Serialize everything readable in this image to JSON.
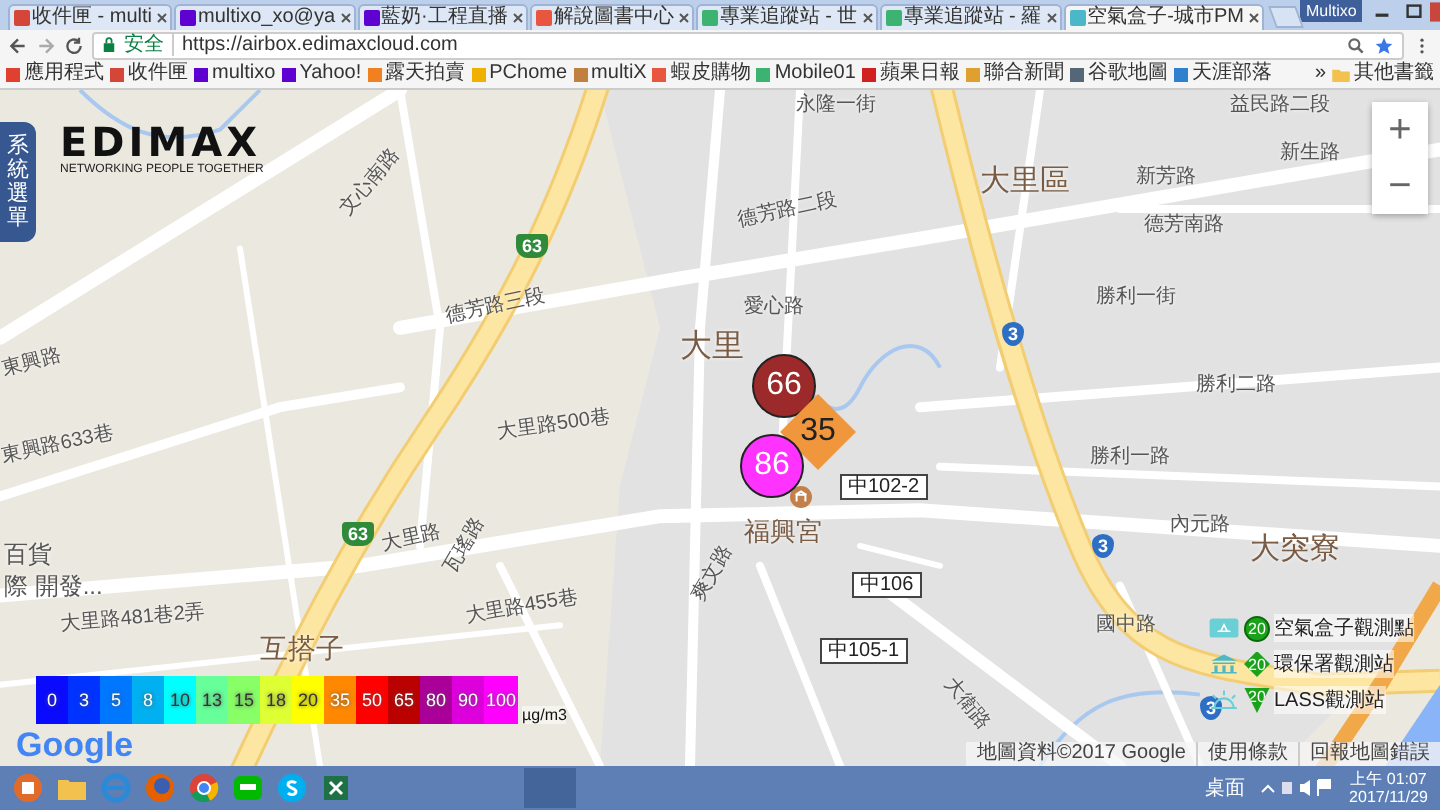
{
  "browser": {
    "tabs": [
      {
        "title": "收件匣 - multi",
        "color": "#d44638",
        "selected": false
      },
      {
        "title": "multixo_xo@ya",
        "color": "#5f01d1",
        "selected": false
      },
      {
        "title": "藍奶·工程直播",
        "color": "#5f01d1",
        "selected": false
      },
      {
        "title": "解說圖書中心",
        "color": "#e8563f",
        "selected": false
      },
      {
        "title": "專業追蹤站 - 世",
        "color": "#3cb371",
        "selected": false
      },
      {
        "title": "專業追蹤站 - 羅",
        "color": "#3cb371",
        "selected": false
      },
      {
        "title": "空氣盒子-城市PM",
        "color": "#4ab8c8",
        "selected": true
      }
    ],
    "profile": "Multixo",
    "security": "安全",
    "url": "https://airbox.edimaxcloud.com",
    "bookmarks": [
      {
        "label": "應用程式",
        "color": "#e04030"
      },
      {
        "label": "收件匣",
        "color": "#d44638"
      },
      {
        "label": "multixo",
        "color": "#5f01d1"
      },
      {
        "label": "Yahoo!",
        "color": "#5f01d1"
      },
      {
        "label": "露天拍賣",
        "color": "#f08020"
      },
      {
        "label": "PChome",
        "color": "#f0b000"
      },
      {
        "label": "multiX",
        "color": "#c08040"
      },
      {
        "label": "蝦皮購物",
        "color": "#e8563f"
      },
      {
        "label": "Mobile01",
        "color": "#3cb371"
      },
      {
        "label": "蘋果日報",
        "color": "#d02020"
      },
      {
        "label": "聯合新聞",
        "color": "#e0a030"
      },
      {
        "label": "谷歌地圖",
        "color": "#556677"
      },
      {
        "label": "天涯部落",
        "color": "#3080d0"
      }
    ],
    "more": "»",
    "other_bookmarks": "其他書籤"
  },
  "map": {
    "labels": [
      "大里區",
      "大里",
      "福興宮",
      "大突寮",
      "內元路",
      "國中路",
      "大衛路",
      "大里路",
      "大里路500巷",
      "大里路455巷",
      "大里路481巷2弄",
      "東興路633巷",
      "東興路",
      "德芳路三段",
      "德芳路二段",
      "新芳路",
      "德芳南路",
      "新生路",
      "永隆一街",
      "益民路二段",
      "勝利一街",
      "勝利二路",
      "勝利一路",
      "愛心路",
      "文心南路",
      "瓦瑤路",
      "爽文路",
      "互搭子",
      "百貨",
      "際 開發..."
    ],
    "route_shields": [
      {
        "text": "63",
        "kind": "national"
      },
      {
        "text": "63",
        "kind": "national"
      },
      {
        "text": "3",
        "kind": "provincial"
      },
      {
        "text": "3",
        "kind": "provincial"
      },
      {
        "text": "3",
        "kind": "provincial"
      }
    ],
    "road_codes": [
      "中102-2",
      "中106",
      "中105-1"
    ],
    "markers": [
      {
        "value": "66",
        "color": "#9c2a2a",
        "kind": "circle"
      },
      {
        "value": "35",
        "color": "#f0963c",
        "kind": "diamond"
      },
      {
        "value": "86",
        "color": "#ff33ff",
        "kind": "circle"
      }
    ],
    "side_menu": "系統選單",
    "logo": {
      "brand": "EDIMAX",
      "tagline": "NETWORKING PEOPLE TOGETHER"
    },
    "zoom": {
      "in": "+",
      "out": "−"
    },
    "pm_legend": {
      "steps": [
        {
          "value": "0",
          "color": "#0a0aff"
        },
        {
          "value": "3",
          "color": "#0033ff"
        },
        {
          "value": "5",
          "color": "#0077ff"
        },
        {
          "value": "8",
          "color": "#00b0f0"
        },
        {
          "value": "10",
          "color": "#00ffff"
        },
        {
          "value": "13",
          "color": "#66ff99"
        },
        {
          "value": "15",
          "color": "#88ff66"
        },
        {
          "value": "18",
          "color": "#ddff33"
        },
        {
          "value": "20",
          "color": "#ffff00"
        },
        {
          "value": "35",
          "color": "#ff8800"
        },
        {
          "value": "50",
          "color": "#ff0000"
        },
        {
          "value": "65",
          "color": "#bb0000"
        },
        {
          "value": "80",
          "color": "#aa0099"
        },
        {
          "value": "90",
          "color": "#dd00dd"
        },
        {
          "value": "100",
          "color": "#ff00ff"
        }
      ],
      "unit": "µg/m3"
    },
    "station_legend": [
      {
        "label": "空氣盒子觀測點",
        "kind": "airbox",
        "value": "20"
      },
      {
        "label": "環保署觀測站",
        "kind": "epa",
        "value": "20"
      },
      {
        "label": "LASS觀測站",
        "kind": "lass",
        "value": "20"
      }
    ],
    "google": "Google",
    "attribution": [
      "地圖資料©2017 Google",
      "使用條款",
      "回報地圖錯誤"
    ]
  },
  "taskbar": {
    "desktop": "桌面",
    "time": "上午 01:07",
    "date": "2017/11/29"
  }
}
